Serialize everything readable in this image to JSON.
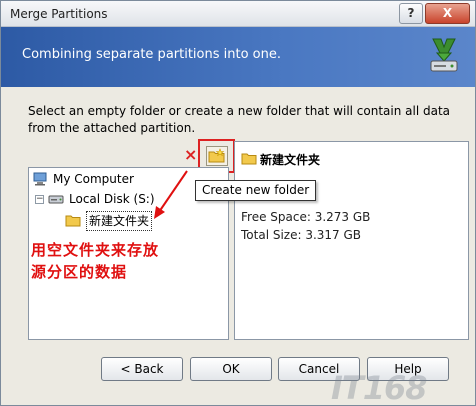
{
  "window": {
    "title": "Merge Partitions",
    "help_glyph": "?",
    "close_glyph": "X"
  },
  "banner": {
    "text": "Combining separate partitions into one."
  },
  "instruction": {
    "text": "Select an empty folder or create a new folder that will contain all data from the attached partition."
  },
  "toolbar": {
    "delete_glyph": "×",
    "tooltip": "Create new folder"
  },
  "tree": {
    "items": [
      {
        "label": "My Computer",
        "expander": ""
      },
      {
        "label": "Local Disk (S:)",
        "expander": "−"
      },
      {
        "label": "新建文件夹",
        "expander": ""
      }
    ]
  },
  "annotation": {
    "line1": "用空文件夹来存放",
    "line2": "源分区的数据"
  },
  "info": {
    "title": "新建文件夹",
    "free_space": "Free Space: 3.273 GB",
    "total_size": "Total Size: 3.317 GB"
  },
  "buttons": {
    "back": "< Back",
    "ok": "OK",
    "cancel": "Cancel",
    "help": "Help"
  },
  "watermark": {
    "text": "IT168"
  },
  "colors": {
    "accent": "#2d5aa5",
    "annotation": "#e01010",
    "highlight": "#dd2222"
  }
}
